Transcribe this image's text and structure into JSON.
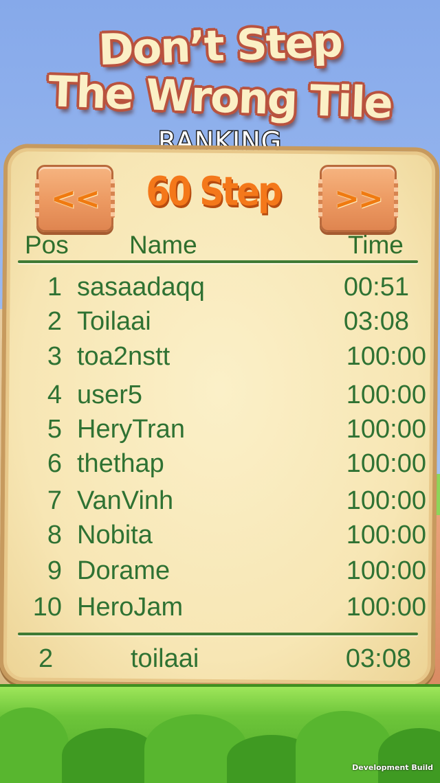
{
  "title": {
    "line1": "Don’t Step",
    "line2": "The Wrong Tile",
    "subtitle": "RANKING"
  },
  "navigation": {
    "prev_label": "<<",
    "next_label": ">>",
    "level_label": "60 Step"
  },
  "table": {
    "headers": {
      "pos": "Pos",
      "name": "Name",
      "time": "Time"
    },
    "rows": [
      {
        "pos": "1",
        "name": "sasaadaqq",
        "time": "00:51"
      },
      {
        "pos": "2",
        "name": "Toilaai",
        "time": "03:08"
      },
      {
        "pos": "3",
        "name": "toa2nstt",
        "time": "100:00"
      },
      {
        "pos": "4",
        "name": "user5",
        "time": "100:00"
      },
      {
        "pos": "5",
        "name": "HeryTran",
        "time": "100:00"
      },
      {
        "pos": "6",
        "name": "thethap",
        "time": "100:00"
      },
      {
        "pos": "7",
        "name": "VanVinh",
        "time": "100:00"
      },
      {
        "pos": "8",
        "name": "Nobita",
        "time": "100:00"
      },
      {
        "pos": "9",
        "name": "Dorame",
        "time": "100:00"
      },
      {
        "pos": "10",
        "name": "HeroJam",
        "time": "100:00"
      }
    ],
    "current_player": {
      "pos": "2",
      "name": "toilaai",
      "time": "03:08"
    }
  },
  "footer": {
    "build_label": "Development Build"
  },
  "colors": {
    "text_green": "#2f7233",
    "accent_orange": "#f4781a",
    "board_fill": "#f7e6b4",
    "grass_green": "#6dc53a"
  }
}
